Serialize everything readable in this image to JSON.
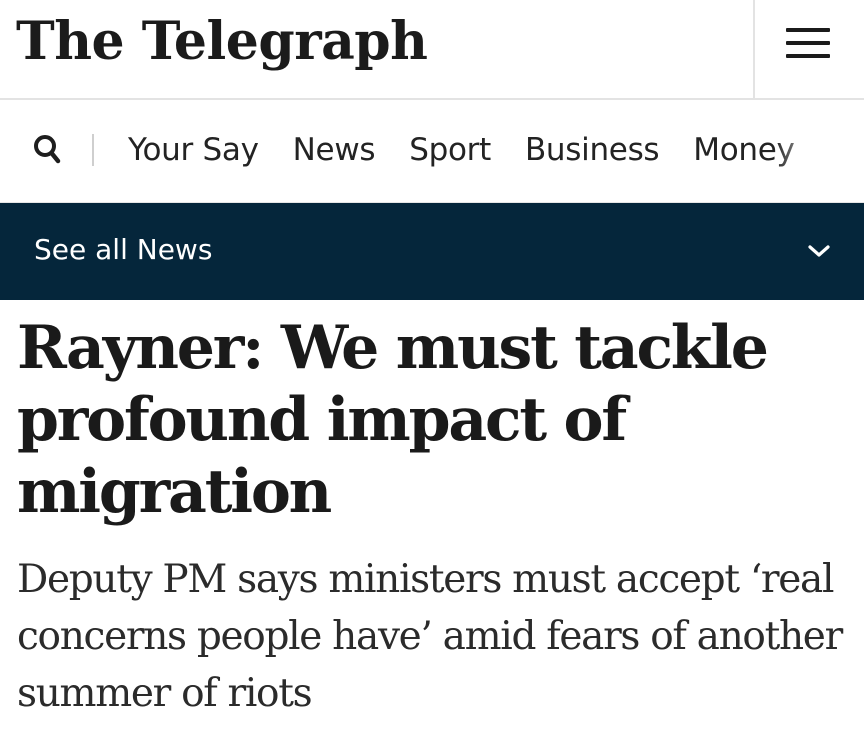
{
  "header": {
    "logo_text": "The Telegraph",
    "menu_icon": "hamburger-menu-icon"
  },
  "nav": {
    "search_icon": "search-icon",
    "items": [
      {
        "label": "Your Say"
      },
      {
        "label": "News"
      },
      {
        "label": "Sport"
      },
      {
        "label": "Business"
      },
      {
        "label": "Money"
      }
    ]
  },
  "section": {
    "label": "See all News",
    "chevron_icon": "chevron-down-icon"
  },
  "article": {
    "headline": "Rayner: We must tackle profound impact of migration",
    "standfirst": "Deputy PM says ministers must accept ‘real concerns people have’ amid fears of another summer of riots"
  },
  "colors": {
    "section_bar": "#05263b",
    "text": "#1a1a1a",
    "divider": "#e3e3e3"
  }
}
